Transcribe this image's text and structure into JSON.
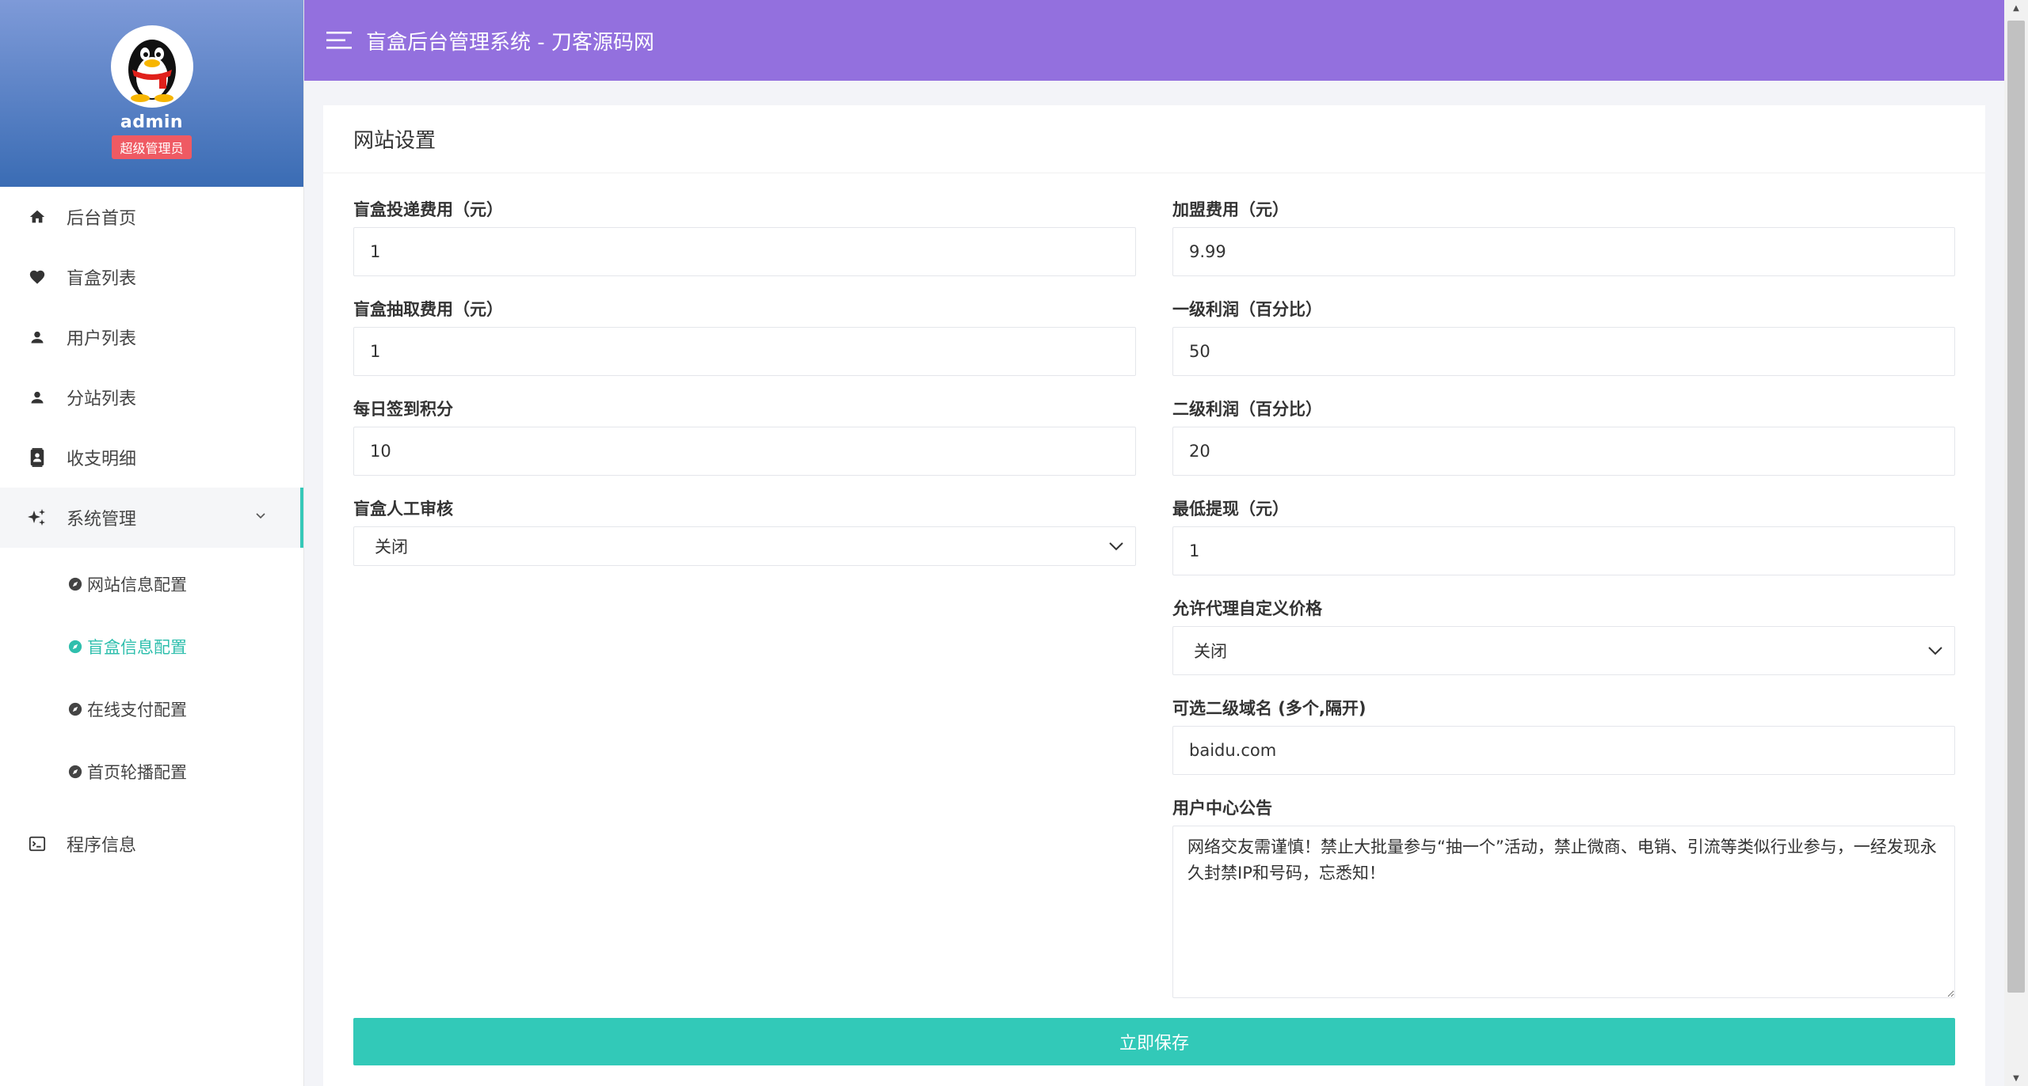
{
  "sidebar": {
    "username": "admin",
    "role": "超级管理员",
    "menu": [
      {
        "label": "后台首页",
        "icon": "home-icon"
      },
      {
        "label": "盲盒列表",
        "icon": "heart-icon"
      },
      {
        "label": "用户列表",
        "icon": "user-icon"
      },
      {
        "label": "分站列表",
        "icon": "user-icon"
      },
      {
        "label": "收支明细",
        "icon": "contacts-icon"
      },
      {
        "label": "系统管理",
        "icon": "sparkle-icon"
      },
      {
        "label": "程序信息",
        "icon": "terminal-icon"
      }
    ],
    "submenu": [
      {
        "label": "网站信息配置",
        "icon": "compass-icon"
      },
      {
        "label": "盲盒信息配置",
        "icon": "compass-icon"
      },
      {
        "label": "在线支付配置",
        "icon": "compass-icon"
      },
      {
        "label": "首页轮播配置",
        "icon": "compass-icon"
      }
    ],
    "active_submenu": "盲盒信息配置"
  },
  "header": {
    "title": "盲盒后台管理系统 - 刀客源码网"
  },
  "card": {
    "title": "网站设置"
  },
  "form": {
    "left": {
      "delivery_fee": {
        "label": "盲盒投递费用（元）",
        "value": "1"
      },
      "draw_fee": {
        "label": "盲盒抽取费用（元）",
        "value": "1"
      },
      "daily_checkin": {
        "label": "每日签到积分",
        "value": "10"
      },
      "manual_review": {
        "label": "盲盒人工审核",
        "value": "关闭"
      }
    },
    "right": {
      "join_fee": {
        "label": "加盟费用（元）",
        "value": "9.99"
      },
      "level1_profit": {
        "label": "一级利润（百分比）",
        "value": "50"
      },
      "level2_profit": {
        "label": "二级利润（百分比）",
        "value": "20"
      },
      "min_withdraw": {
        "label": "最低提现（元）",
        "value": "1"
      },
      "custom_price": {
        "label": "允许代理自定义价格",
        "value": "关闭"
      },
      "subdomains": {
        "label": "可选二级域名 (多个,隔开)",
        "value": "baidu.com"
      },
      "notice": {
        "label": "用户中心公告",
        "value": "网络交友需谨慎！禁止大批量参与“抽一个”活动，禁止微商、电销、引流等类似行业参与，一经发现永久封禁IP和号码，忘悉知！"
      }
    }
  },
  "save_button": "立即保存",
  "colors": {
    "header": "#9370de",
    "accent": "#32c9b8",
    "badge": "#ef5a63"
  }
}
